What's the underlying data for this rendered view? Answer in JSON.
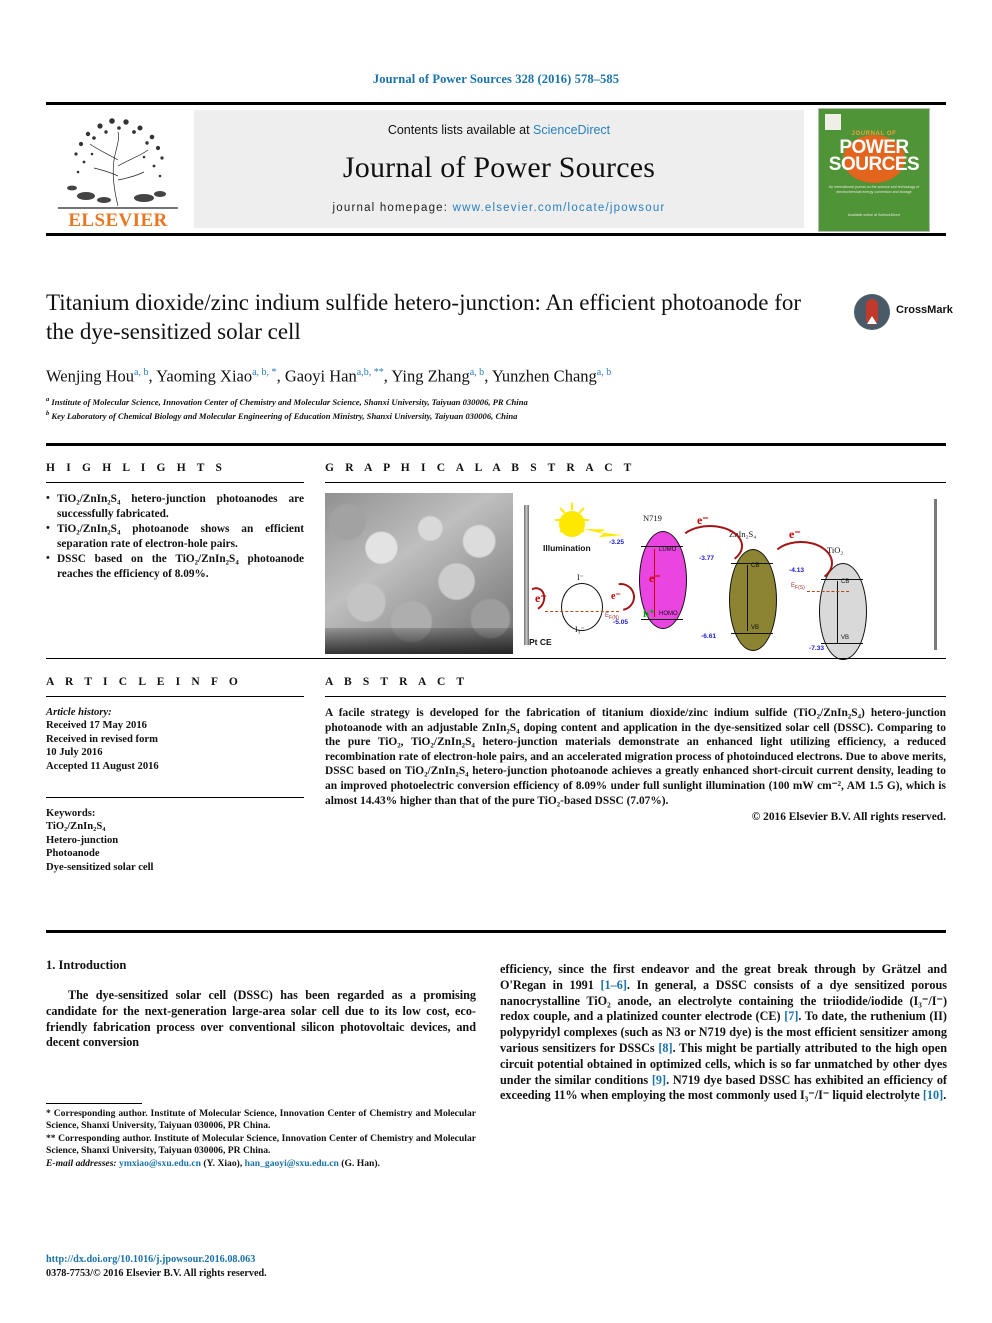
{
  "running_head": "Journal of Power Sources 328 (2016) 578–585",
  "masthead": {
    "contents_prefix": "Contents lists available at ",
    "sciencedirect": "ScienceDirect",
    "journal_title": "Journal of Power Sources",
    "homepage_label": "journal homepage: ",
    "homepage_url": "www.elsevier.com/locate/jpowsour",
    "publisher": "ELSEVIER",
    "cover": {
      "line_journal_of": "JOURNAL OF",
      "line_power": "POWER",
      "line_sources": "SOURCES",
      "blurb": "An international journal on the science and technology of electrochemical energy conversion and storage",
      "footer": "Available online at ScienceDirect",
      "bg_color": "#4f9436",
      "accent_color": "#e2641d"
    }
  },
  "article": {
    "title": "Titanium dioxide/zinc indium sulfide hetero-junction: An efficient photoanode for the dye-sensitized solar cell",
    "crossmark_label": "CrossMark",
    "authors": [
      {
        "name": "Wenjing Hou",
        "marks": "a, b"
      },
      {
        "name": "Yaoming Xiao",
        "marks": "a, b, *"
      },
      {
        "name": "Gaoyi Han",
        "marks": "a,b, **"
      },
      {
        "name": "Ying Zhang",
        "marks": "a, b"
      },
      {
        "name": "Yunzhen Chang",
        "marks": "a, b"
      }
    ],
    "affiliations": [
      {
        "mark": "a",
        "text": "Institute of Molecular Science, Innovation Center of Chemistry and Molecular Science, Shanxi University, Taiyuan 030006, PR China"
      },
      {
        "mark": "b",
        "text": "Key Laboratory of Chemical Biology and Molecular Engineering of Education Ministry, Shanxi University, Taiyuan 030006, China"
      }
    ]
  },
  "highlights": {
    "heading": "H I G H L I G H T S",
    "items": [
      "TiO₂/ZnIn₂S₄ hetero-junction photoanodes are successfully fabricated.",
      "TiO₂/ZnIn₂S₄ photoanode shows an efficient separation rate of electron-hole pairs.",
      "DSSC based on the TiO₂/ZnIn₂S₄ photoanode reaches the efficiency of 8.09%."
    ]
  },
  "graphical_abstract": {
    "heading": "G R A P H I C A L   A B S T R A C T",
    "sem_caption": "",
    "diagram": {
      "illumination_label": "Illumination",
      "counter_electrode_label": "Pt CE",
      "materials": [
        {
          "name": "N719",
          "top_level": "-3.25",
          "bottom_level": "-5.05",
          "top_tag": "LUMO",
          "bottom_tag": "HOMO",
          "color": "#ea45e0"
        },
        {
          "name": "ZnIn₂S₄",
          "top_level": "-3.77",
          "bottom_level": "-6.61",
          "top_tag": "CB",
          "bottom_tag": "VB",
          "color": "#8c8433"
        },
        {
          "name": "TiO₂",
          "top_level": "-4.13",
          "bottom_level": "-7.33",
          "top_tag": "CB",
          "bottom_tag": "VB",
          "color": "#d9d9d9"
        }
      ],
      "carriers": {
        "electron": "e⁻",
        "hole": "h⁺"
      },
      "redox": {
        "oxidized": "I⁻",
        "reduced": "I₃⁻",
        "fermi_label": "E"
      }
    }
  },
  "article_info": {
    "heading": "A R T I C L E   I N F O",
    "history_label": "Article history:",
    "history": [
      "Received 17 May 2016",
      "Received in revised form",
      "10 July 2016",
      "Accepted 11 August 2016"
    ],
    "keywords_label": "Keywords:",
    "keywords": [
      "TiO₂/ZnIn₂S₄",
      "Hetero-junction",
      "Photoanode",
      "Dye-sensitized solar cell"
    ]
  },
  "abstract": {
    "heading": "A B S T R A C T",
    "text": "A facile strategy is developed for the fabrication of titanium dioxide/zinc indium sulfide (TiO₂/ZnIn₂S₄) hetero-junction photoanode with an adjustable ZnIn₂S₄ doping content and application in the dye-sensitized solar cell (DSSC). Comparing to the pure TiO₂, TiO₂/ZnIn₂S₄ hetero-junction materials demonstrate an enhanced light utilizing efficiency, a reduced recombination rate of electron-hole pairs, and an accelerated migration process of photoinduced electrons. Due to above merits, DSSC based on TiO₂/ZnIn₂S₄ hetero-junction photoanode achieves a greatly enhanced short-circuit current density, leading to an improved photoelectric conversion efficiency of 8.09% under full sunlight illumination (100 mW cm⁻², AM 1.5 G), which is almost 14.43% higher than that of the pure TiO₂-based DSSC (7.07%).",
    "copyright": "© 2016 Elsevier B.V. All rights reserved."
  },
  "body": {
    "section_heading": "1. Introduction",
    "left_column": "The dye-sensitized solar cell (DSSC) has been regarded as a promising candidate for the next-generation large-area solar cell due to its low cost, eco-friendly fabrication process over conventional silicon photovoltaic devices, and decent conversion",
    "right_column_parts": [
      "efficiency, since the first endeavor and the great break through by Grätzel and O'Regan in 1991 ",
      "[1–6]",
      ". In general, a DSSC consists of a dye sensitized porous nanocrystalline TiO₂ anode, an electrolyte containing the triiodide/iodide (I₃⁻/I⁻) redox couple, and a platinized counter electrode (CE) ",
      "[7]",
      ". To date, the ruthenium (II) polypyridyl complexes (such as N3 or N719 dye) is the most efficient sensitizer among various sensitizers for DSSCs ",
      "[8]",
      ". This might be partially attributed to the high open circuit potential obtained in optimized cells, which is so far unmatched by other dyes under the similar conditions ",
      "[9]",
      ". N719 dye based DSSC has exhibited an efficiency of exceeding 11% when employing the most commonly used I₃⁻/I⁻ liquid electrolyte ",
      "[10]",
      "."
    ]
  },
  "footnotes": {
    "corresponding_1": "* Corresponding author. Institute of Molecular Science, Innovation Center of Chemistry and Molecular Science, Shanxi University, Taiyuan 030006, PR China.",
    "corresponding_2": "** Corresponding author. Institute of Molecular Science, Innovation Center of Chemistry and Molecular Science, Shanxi University, Taiyuan 030006, PR China.",
    "email_label": "E-mail addresses:",
    "email_1": "ymxiao@sxu.edu.cn",
    "email_1_owner": "(Y. Xiao),",
    "email_2": "han_gaoyi@sxu.edu.cn",
    "email_2_owner": "(G. Han)."
  },
  "footer": {
    "doi": "http://dx.doi.org/10.1016/j.jpowsour.2016.08.063",
    "issn_line": "0378-7753/© 2016 Elsevier B.V. All rights reserved."
  }
}
